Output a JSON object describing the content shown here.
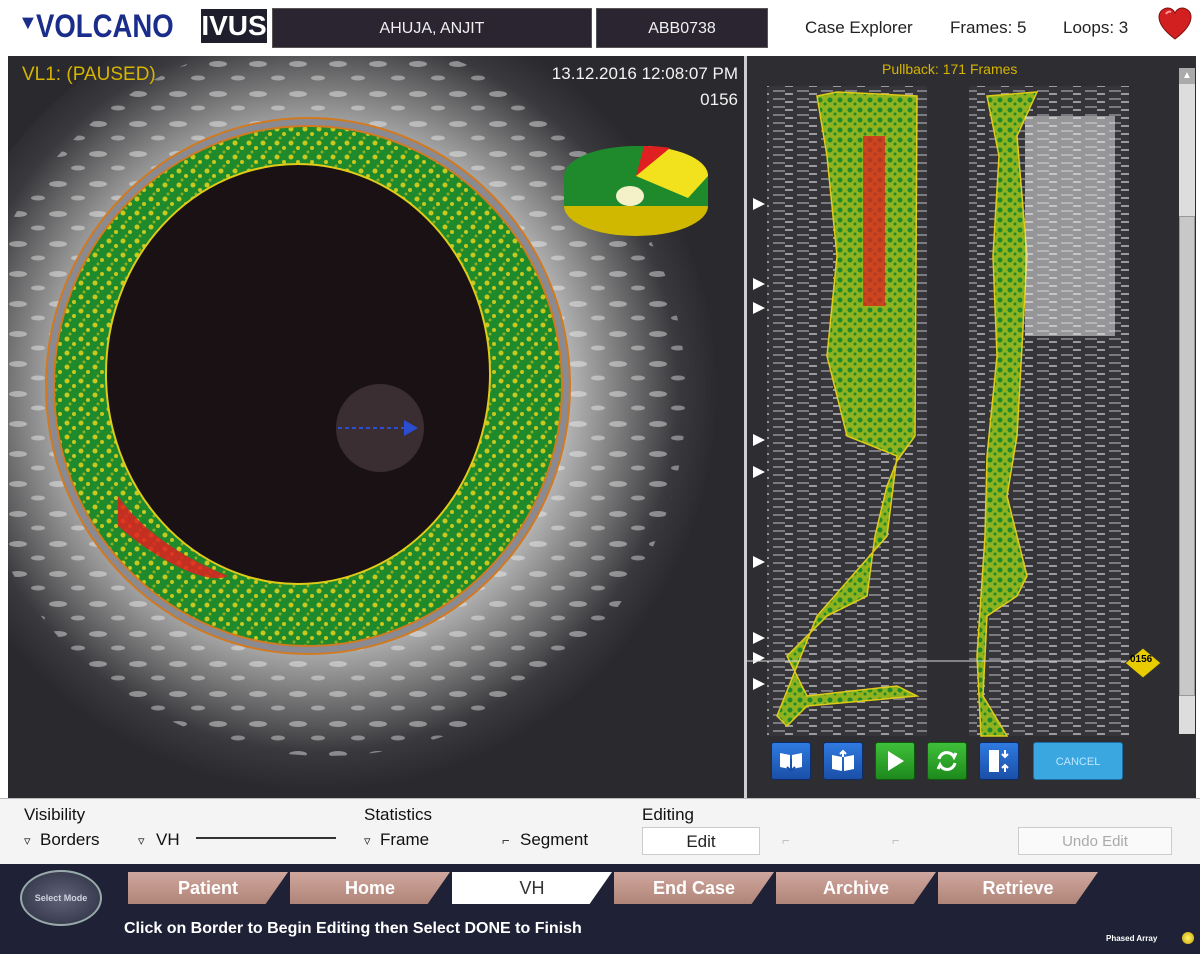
{
  "header": {
    "logo_mark": "▼",
    "logo_brand": "VOLCANO",
    "logo_product": "IVUS",
    "patient_name": "AHUJA, ANJIT",
    "patient_id": "ABB0738",
    "case_explorer": "Case Explorer",
    "frames": "Frames: 5",
    "loops": "Loops: 3",
    "heart_icon": "heart-icon",
    "heart_color": "#d22020"
  },
  "ivus": {
    "status": "VL1: (PAUSED)",
    "datetime": "13.12.2016 12:08:07 PM",
    "frame": "0156",
    "tissue_colors": {
      "fibrous": "#1f8a2c",
      "fibro_fatty": "#c8c81e",
      "necrotic_core": "#e02020",
      "dense_calcium": "#f4f0d8"
    }
  },
  "longitudinal": {
    "pullback": "Pullback: 171 Frames",
    "frame_marker": "0156",
    "cancel_label": "CANCEL"
  },
  "controls": {
    "bookmark_icon": "bookmark-down-icon",
    "book_icon": "open-book-icon",
    "play_icon": "play-icon",
    "loop_icon": "refresh-icon",
    "compress_icon": "compress-icon"
  },
  "options": {
    "visibility_title": "Visibility",
    "borders": "Borders",
    "vh": "VH",
    "statistics_title": "Statistics",
    "frame": "Frame",
    "segment": "Segment",
    "editing_title": "Editing",
    "edit": "Edit",
    "undo_edit": "Undo Edit"
  },
  "nav": {
    "select_mode": "Select Mode",
    "tabs": [
      "Patient",
      "Home",
      "VH",
      "End Case",
      "Archive",
      "Retrieve"
    ],
    "active_tab": "VH",
    "instruction": "Click on Border to Begin Editing then Select DONE to Finish",
    "phased_array": "Phased Array"
  }
}
